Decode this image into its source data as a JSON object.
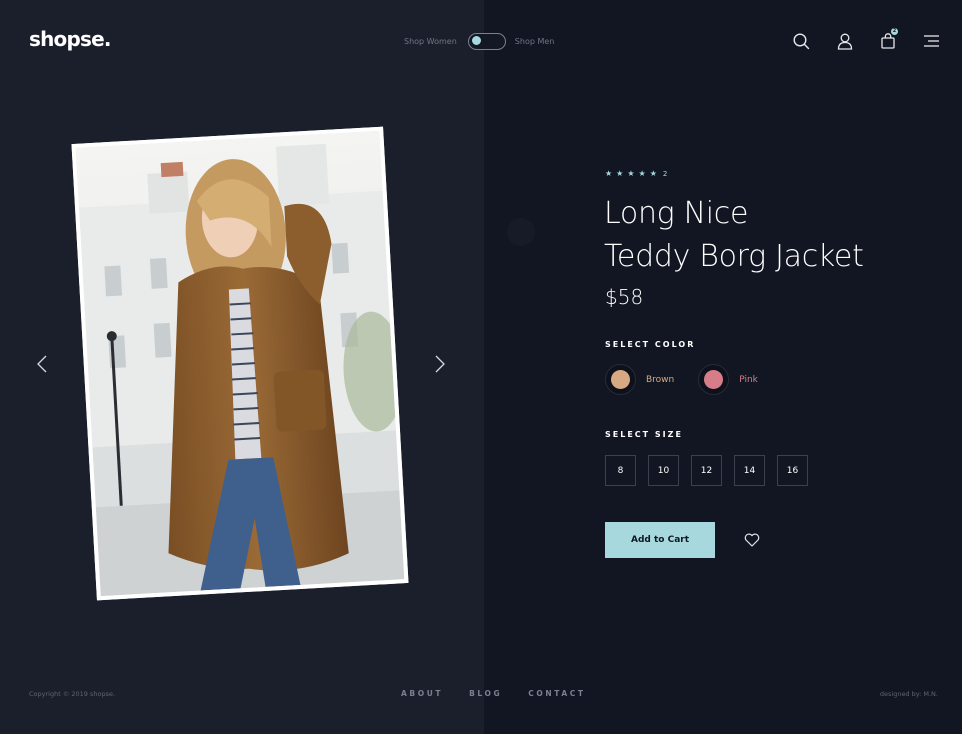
{
  "header": {
    "logo": "shopse.",
    "toggle": {
      "left_label": "Shop Women",
      "right_label": "Shop Men",
      "active": "women"
    },
    "cart_count": "2",
    "icons": [
      "search-icon",
      "user-icon",
      "cart-icon",
      "menu-icon"
    ]
  },
  "product": {
    "rating_count": "2",
    "stars": 5,
    "title_line1": "Long Nice",
    "title_line2": "Teddy Borg Jacket",
    "price": "$58",
    "color_label": "SELECT COLOR",
    "colors": [
      {
        "name": "Brown",
        "hex": "#d6a982",
        "text_hex": "#d6a982"
      },
      {
        "name": "Pink",
        "hex": "#d77d8a",
        "text_hex": "#d77d8a"
      }
    ],
    "size_label": "SELECT SIZE",
    "sizes": [
      "8",
      "10",
      "12",
      "14",
      "16"
    ],
    "add_to_cart": "Add to Cart"
  },
  "footer": {
    "copyright": "Copyright © 2019 shopse.",
    "nav": [
      "ABOUT",
      "BLOG",
      "CONTACT"
    ],
    "designed_by": "designed by: M.N."
  },
  "colors": {
    "accent": "#a7d8dd",
    "panel_left": "#1b1f2b",
    "panel_right": "#121622"
  }
}
